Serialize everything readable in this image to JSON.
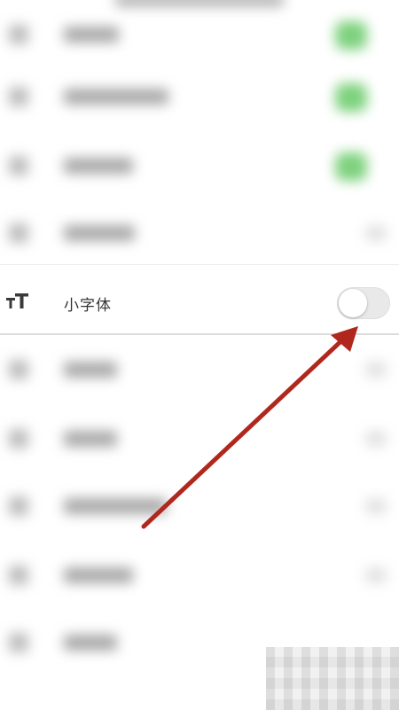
{
  "setting": {
    "label": "小字体",
    "icon": "text-size-icon",
    "toggle_state": "off"
  },
  "colors": {
    "arrow": "#b0281d",
    "toggle_on": "#4cd964",
    "toggle_off_track": "#e9e9e9"
  }
}
